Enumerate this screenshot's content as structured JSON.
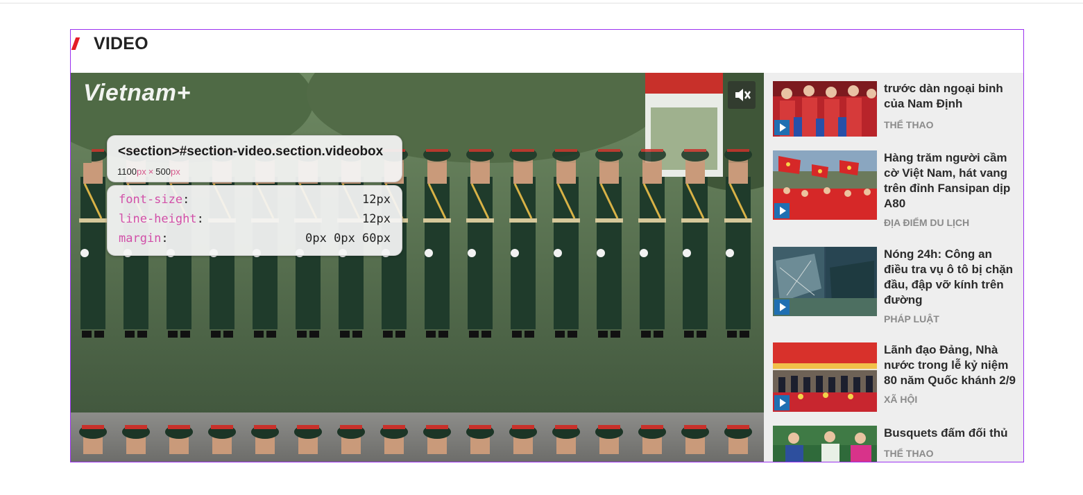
{
  "section": {
    "title": "VIDEO"
  },
  "player": {
    "logo_text": "Vietnam+",
    "mute_icon": "volume-mute-icon"
  },
  "devtools": {
    "selector": "<section>#section-video.section.videobox",
    "width": "1100",
    "height": "500",
    "unit": "px",
    "times": "×",
    "props": [
      {
        "name": "font-size",
        "value": "12px"
      },
      {
        "name": "line-height",
        "value": "12px"
      },
      {
        "name": "margin",
        "value": "0px 0px 60px"
      }
    ]
  },
  "sidebar": {
    "items": [
      {
        "title": "trước dàn ngoại binh của Nam Định",
        "category": "THỂ THAO"
      },
      {
        "title": "Hàng trăm người cầm cờ Việt Nam, hát vang trên đỉnh Fansipan dịp A80",
        "category": "ĐỊA ĐIỂM DU LỊCH"
      },
      {
        "title": "Nóng 24h: Công an điều tra vụ ô tô bị chặn đầu, đập vỡ kính trên đường",
        "category": "PHÁP LUẬT"
      },
      {
        "title": "Lãnh đạo Đảng, Nhà nước trong lễ kỷ niệm 80 năm Quốc khánh 2/9",
        "category": "XÃ HỘI"
      },
      {
        "title": "Busquets đấm đối thủ",
        "category": "THỂ THAO"
      }
    ]
  },
  "colors": {
    "accent": "#e41e26",
    "outline": "#9b30f0",
    "play": "#1f6fb2"
  }
}
